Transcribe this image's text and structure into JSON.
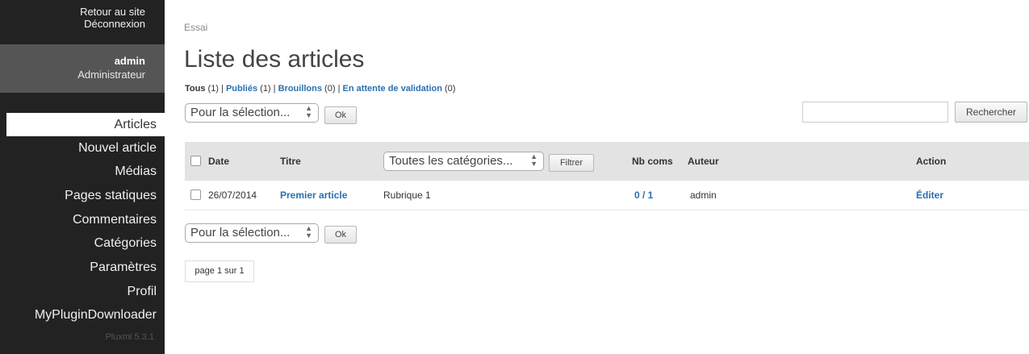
{
  "sidebar": {
    "back_link": "Retour au site",
    "logout_link": "Déconnexion",
    "user": {
      "name": "admin",
      "role": "Administrateur"
    },
    "items": [
      {
        "label": "Articles",
        "active": true
      },
      {
        "label": "Nouvel article"
      },
      {
        "label": "Médias"
      },
      {
        "label": "Pages statiques"
      },
      {
        "label": "Commentaires"
      },
      {
        "label": "Catégories"
      },
      {
        "label": "Paramètres"
      },
      {
        "label": "Profil"
      },
      {
        "label": "MyPluginDownloader"
      }
    ],
    "version": "Pluxml 5.3.1"
  },
  "main": {
    "breadcrumb": "Essai",
    "title": "Liste des articles",
    "filters": {
      "all": {
        "label": "Tous",
        "count": "(1)"
      },
      "published": {
        "label": "Publiés",
        "count": "(1)"
      },
      "drafts": {
        "label": "Brouillons",
        "count": "(0)"
      },
      "pending": {
        "label": "En attente de validation",
        "count": "(0)"
      },
      "separator": "|"
    },
    "bulk_select_value": "Pour la sélection...",
    "ok_label": "Ok",
    "search": {
      "value": "",
      "button_label": "Rechercher"
    },
    "table": {
      "headers": {
        "date": "Date",
        "title": "Titre",
        "nbcoms": "Nb coms",
        "author": "Auteur",
        "action": "Action"
      },
      "category_select_value": "Toutes les catégories...",
      "filter_button": "Filtrer",
      "rows": [
        {
          "date": "26/07/2014",
          "title": "Premier article",
          "category": "Rubrique 1",
          "coms": "0 / 1",
          "author": "admin",
          "action": "Éditer"
        }
      ]
    },
    "pagination": "page 1 sur 1"
  },
  "colors": {
    "sidebar_bg": "#222222",
    "user_box_bg": "#555555",
    "link": "#2a6fb0",
    "table_header_bg": "#e3e3e3"
  }
}
